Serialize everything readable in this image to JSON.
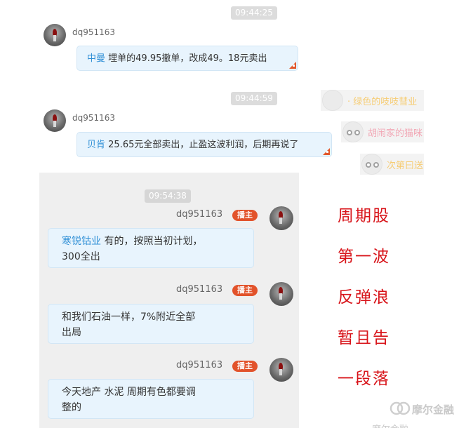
{
  "top_chat": [
    {
      "time": "09:44:25",
      "user": "dq951163",
      "mention": "中曼",
      "text": " 埋单的49.95撤单，改成49。18元卖出"
    },
    {
      "time": "09:44:59",
      "user": "dq951163",
      "mention": "贝肯",
      "text": " 25.65元全部卖出，止盈这波利润，后期再说了"
    }
  ],
  "side_users": [
    {
      "name": "· 绿色的吱吱彗业",
      "icon": "user-avatar-icon"
    },
    {
      "name": "胡闹家的猫咪",
      "icon": "owl-avatar-icon"
    },
    {
      "name": "次第曰送",
      "icon": "owl-avatar-icon"
    }
  ],
  "panel": {
    "time": "09:54:38",
    "badge": "播主",
    "messages": [
      {
        "user": "dq951163",
        "mention": "寒锐钴业",
        "line1_rest": " 有的，按照当初计划，",
        "line2": "300全出"
      },
      {
        "user": "dq951163",
        "mention": "",
        "line1_rest": "和我们石油一样，7%附近全部",
        "line2": "出局"
      },
      {
        "user": "dq951163",
        "mention": "",
        "line1_rest": "今天地产 水泥 周期有色都要调",
        "line2": "整的"
      }
    ]
  },
  "annotation": [
    "周期股",
    "第一波",
    "反弹浪",
    "暂且告",
    "一段落"
  ],
  "watermark": {
    "brand": "摩尔金融",
    "bottom_text": "摩尔金融"
  },
  "colors": {
    "accent": "#2f8fd6",
    "badge": "#e2532b",
    "annotation": "#d8141a"
  }
}
